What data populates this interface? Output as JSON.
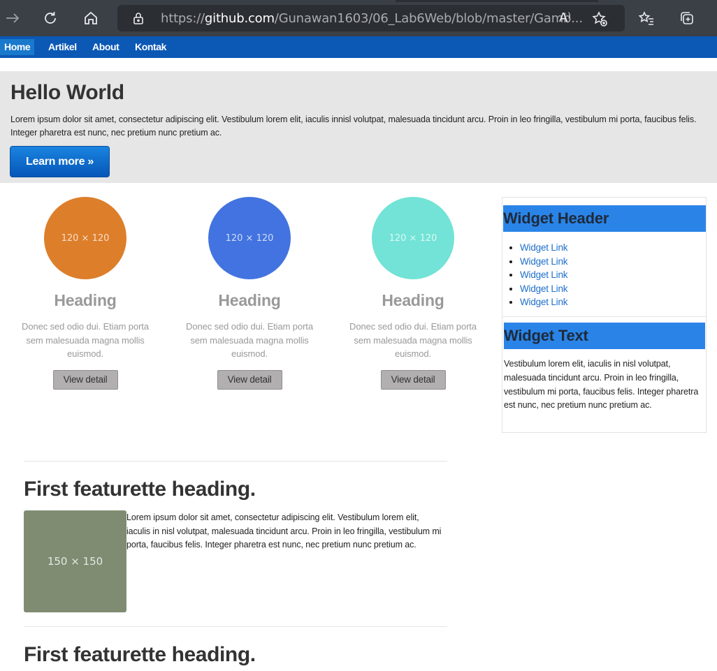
{
  "browser": {
    "url_prefix": "https://",
    "url_host": "github.com",
    "url_path": "/Gunawan1603/06_Lab6Web/blob/master/Gamb...",
    "read_aloud_glyph": "A⁾"
  },
  "nav": {
    "items": [
      "Home",
      "Artikel",
      "About",
      "Kontak"
    ]
  },
  "hero": {
    "title": "Hello World",
    "text": "Lorem ipsum dolor sit amet, consectetur adipiscing elit. Vestibulum lorem elit, iaculis innisl volutpat, malesuada tincidunt arcu. Proin in leo fringilla, vestibulum mi porta, faucibus felis. Integer pharetra est nunc, nec pretium nunc pretium ac.",
    "button": "Learn more »"
  },
  "columns": [
    {
      "placeholder": "120 × 120",
      "color": "#dd7e2b",
      "heading": "Heading",
      "text": "Donec sed odio dui. Etiam porta sem malesuada magna mollis euismod.",
      "button": "View detail"
    },
    {
      "placeholder": "120 × 120",
      "color": "#4273e0",
      "heading": "Heading",
      "text": "Donec sed odio dui. Etiam porta sem malesuada magna mollis euismod.",
      "button": "View detail"
    },
    {
      "placeholder": "120 × 120",
      "color": "#72e3d6",
      "heading": "Heading",
      "text": "Donec sed odio dui. Etiam porta sem malesuada magna mollis euismod.",
      "button": "View detail"
    }
  ],
  "sidebar": {
    "header": "Widget Header",
    "links": [
      "Widget Link",
      "Widget Link",
      "Widget Link",
      "Widget Link",
      "Widget Link"
    ],
    "text_header": "Widget Text",
    "text": "Vestibulum lorem elit, iaculis in nisl volutpat, malesuada tincidunt arcu. Proin in leo fringilla, vestibulum mi porta, faucibus felis. Integer pharetra est nunc, nec pretium nunc pretium ac."
  },
  "featurettes": [
    {
      "heading": "First featurette heading.",
      "image": "150 × 150",
      "image_color": "#7f8c72",
      "text": "Lorem ipsum dolor sit amet, consectetur adipiscing elit. Vestibulum lorem elit, iaculis in nisl volutpat, malesuada tincidunt arcu. Proin in leo fringilla, vestibulum mi porta, faucibus felis. Integer pharetra est nunc, nec pretium nunc pretium ac."
    },
    {
      "heading": "First featurette heading."
    }
  ],
  "colors": {
    "navbar": "#0b58b5",
    "nav_active": "#1979cc",
    "hero_bg": "#e6e6e6",
    "widget_header": "#2a84e8"
  }
}
